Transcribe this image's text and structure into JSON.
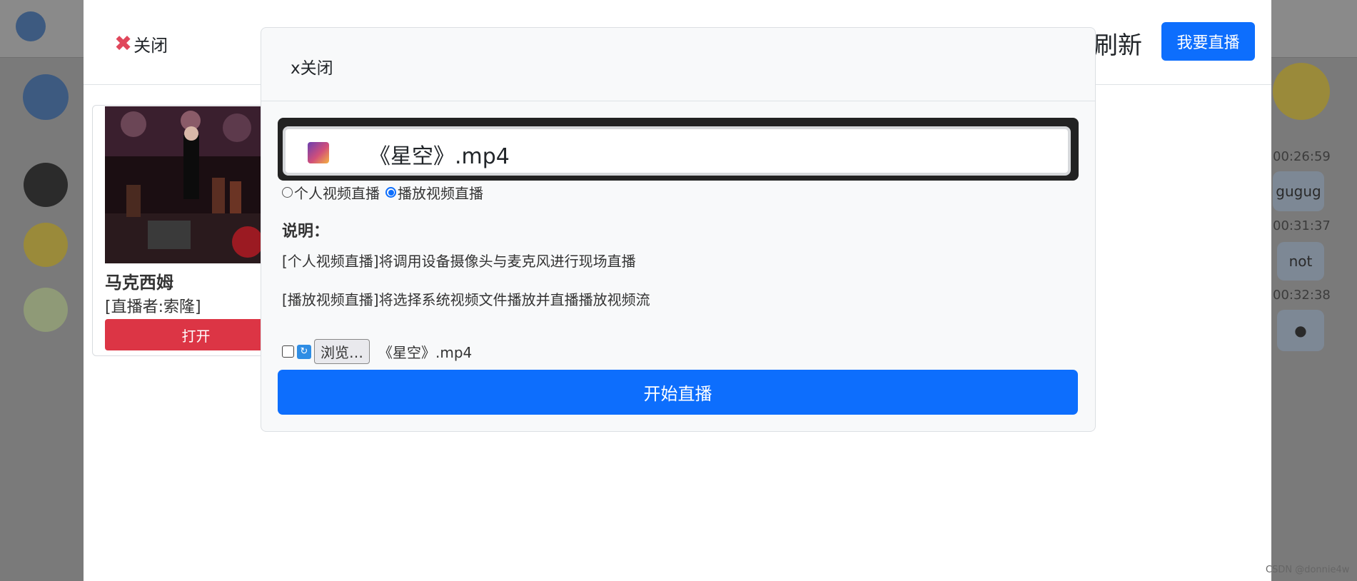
{
  "background": {
    "times": [
      "00:26:59",
      "00:31:37",
      "00:32:38"
    ],
    "bubbles": [
      "gugug",
      "not"
    ]
  },
  "outer_modal": {
    "close_label": "关闭",
    "refresh_label": "刷新",
    "go_live_label": "我要直播",
    "card": {
      "title": "马克西姆",
      "subtitle": "[直播者:索隆]",
      "open_label": "打开"
    }
  },
  "inner_modal": {
    "close_label": "x关闭",
    "selected_file": "《星空》.mp4",
    "radio_options": [
      {
        "label": "个人视频直播",
        "checked": false
      },
      {
        "label": "播放视频直播",
        "checked": true
      }
    ],
    "description_title": "说明：",
    "description_lines": [
      "[个人视频直播]将调用设备摄像头与麦克风进行现场直播",
      "[播放视频直播]将选择系统视频文件播放并直播播放视频流"
    ],
    "browse_label": "浏览…",
    "file_input_value": "《星空》.mp4",
    "start_label": "开始直播"
  },
  "watermark": "CSDN @donnie4w",
  "colors": {
    "primary": "#0d6efd",
    "danger": "#dc3545",
    "close_x": "#e0475b"
  }
}
